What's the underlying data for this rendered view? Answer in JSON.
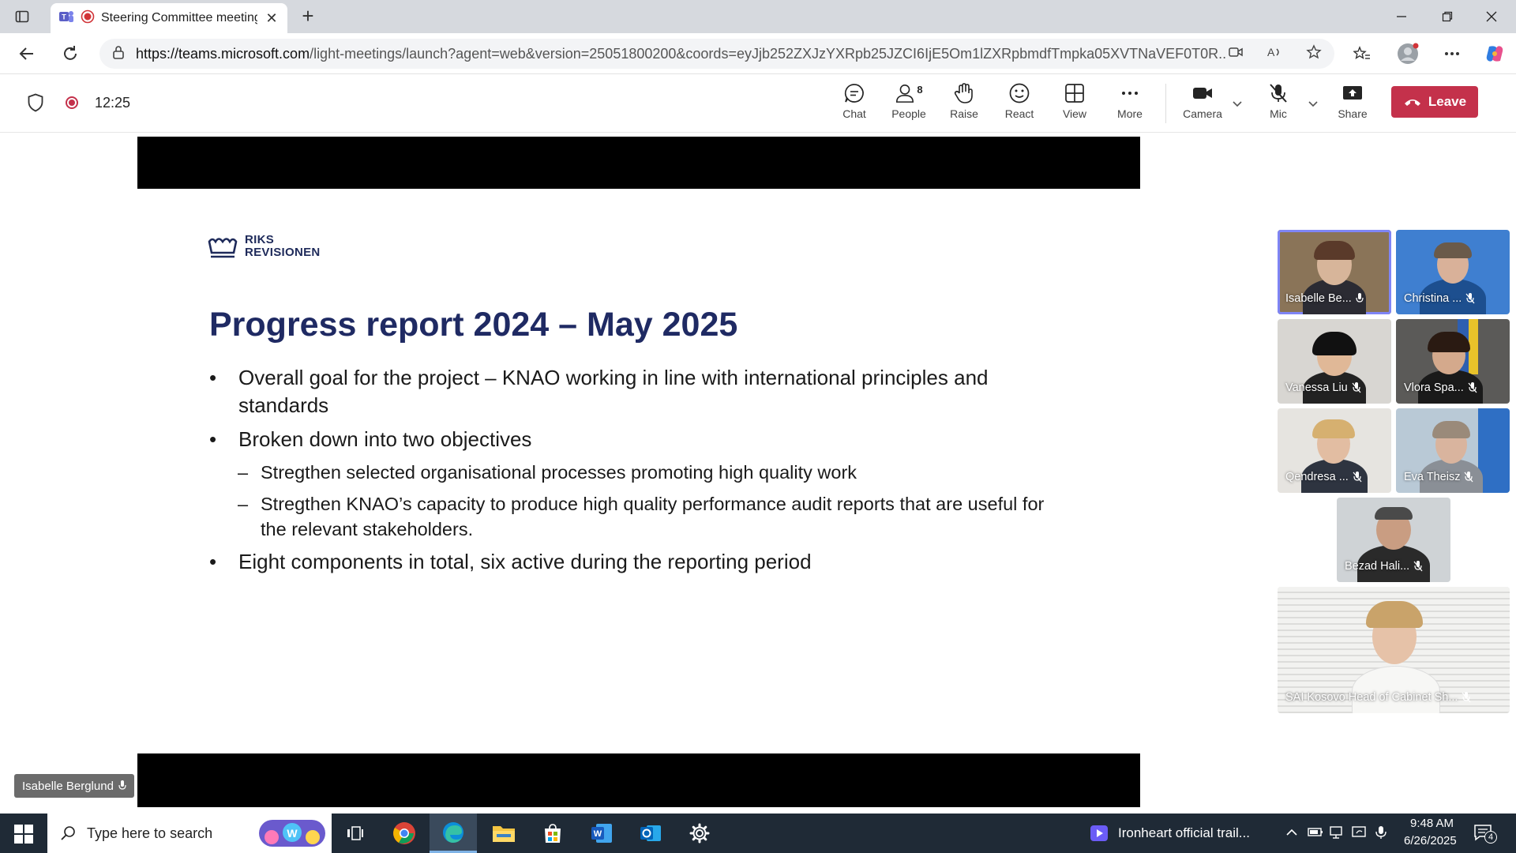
{
  "browser": {
    "tab_title": "Steering Committee meeting",
    "url_domain": "https://teams.microsoft.com",
    "url_rest": "/light-meetings/launch?agent=web&version=25051800200&coords=eyJjb252ZXJzYXRpb25JZCI6IjE5Om1lZXRpbmdfTmpka05XVTNaVEF0T0R..."
  },
  "meeting": {
    "timer": "12:25",
    "people_count": "8",
    "toolbar": {
      "chat": "Chat",
      "people": "People",
      "raise": "Raise",
      "react": "React",
      "view": "View",
      "more": "More",
      "camera": "Camera",
      "mic": "Mic",
      "share": "Share",
      "leave": "Leave"
    },
    "presenter_name": "Isabelle Berglund"
  },
  "slide": {
    "logo_line1": "RIKS",
    "logo_line2": "REVISIONEN",
    "title": "Progress report 2024 – May 2025",
    "bullet1": "Overall goal for the project – KNAO working in line with international principles and standards",
    "bullet2": "Broken down into two objectives",
    "sub1": "Stregthen selected organisational processes promoting high quality work",
    "sub2": "Stregthen KNAO’s capacity to produce high quality performance audit reports that are useful for the relevant stakeholders.",
    "bullet3": "Eight components in total, six active during the reporting period"
  },
  "participants": [
    {
      "name": "Isabelle Be..."
    },
    {
      "name": "Christina ..."
    },
    {
      "name": "Vanessa Liu"
    },
    {
      "name": "Vlora Spa..."
    },
    {
      "name": "Qendresa ..."
    },
    {
      "name": "Eva Theisz"
    },
    {
      "name": "Bezad Hali..."
    },
    {
      "name": "SAI Kosovo Head of Cabinet Sh..."
    }
  ],
  "taskbar": {
    "search_placeholder": "Type here to search",
    "media_title": "Ironheart official trail...",
    "time": "9:48 AM",
    "date": "6/26/2025",
    "notification_count": "4"
  },
  "colors": {
    "leave_red": "#c4314b",
    "slide_title_navy": "#1f2a63",
    "active_speaker_outline": "#7f85f5",
    "taskbar_bg": "#1f2a36"
  }
}
